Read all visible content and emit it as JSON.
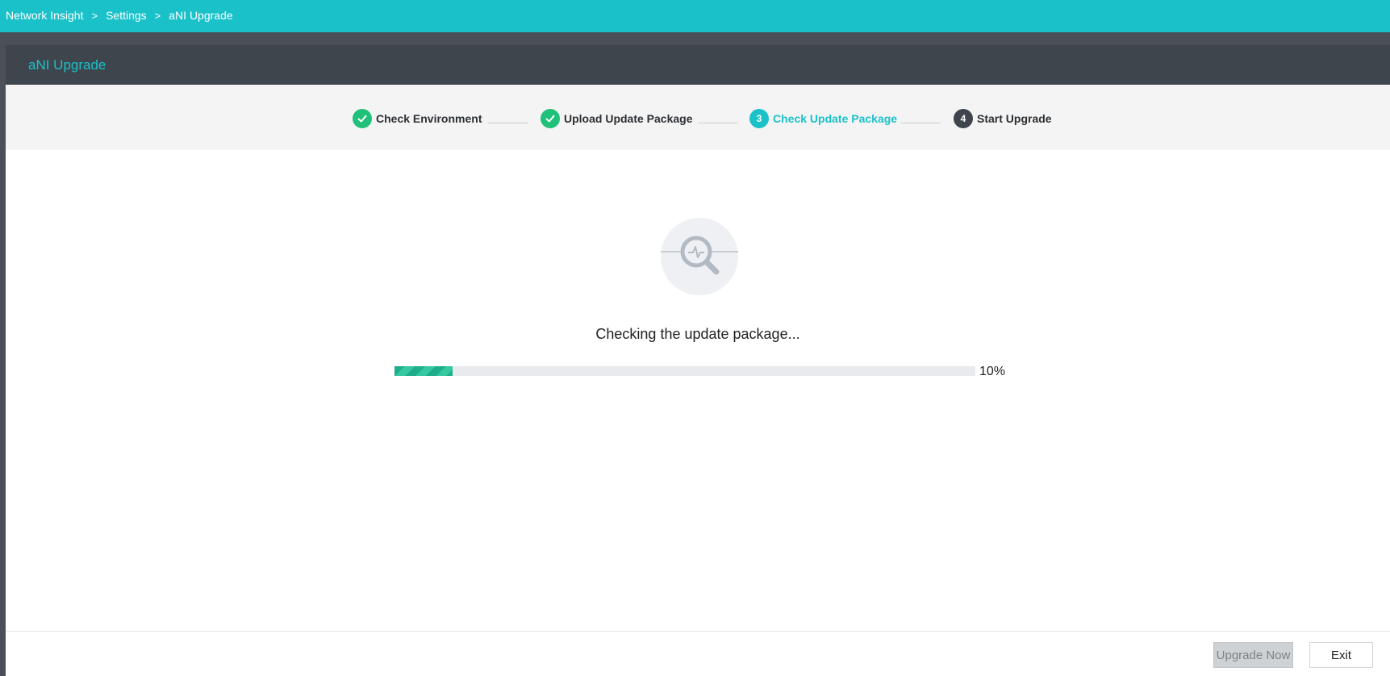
{
  "breadcrumb": {
    "items": [
      "Network Insight",
      "Settings",
      "aNI Upgrade"
    ],
    "separator": ">"
  },
  "panel": {
    "title": "aNI Upgrade"
  },
  "steps": [
    {
      "number": "1",
      "label": "Check Environment",
      "state": "done"
    },
    {
      "number": "2",
      "label": "Upload Update Package",
      "state": "done"
    },
    {
      "number": "3",
      "label": "Check Update Package",
      "state": "active"
    },
    {
      "number": "4",
      "label": "Start Upgrade",
      "state": "pending"
    }
  ],
  "status": {
    "icon": "magnifier-pulse-icon",
    "message": "Checking the update package...",
    "progress": 10,
    "progress_label": "10%"
  },
  "footer": {
    "upgrade_label": "Upgrade Now",
    "upgrade_disabled": true,
    "exit_label": "Exit"
  },
  "colors": {
    "topbar": "#1ac1c9",
    "accent": "#1ac1c9",
    "done": "#1fc17a",
    "pending": "#3e454d",
    "header": "#3e454d"
  }
}
